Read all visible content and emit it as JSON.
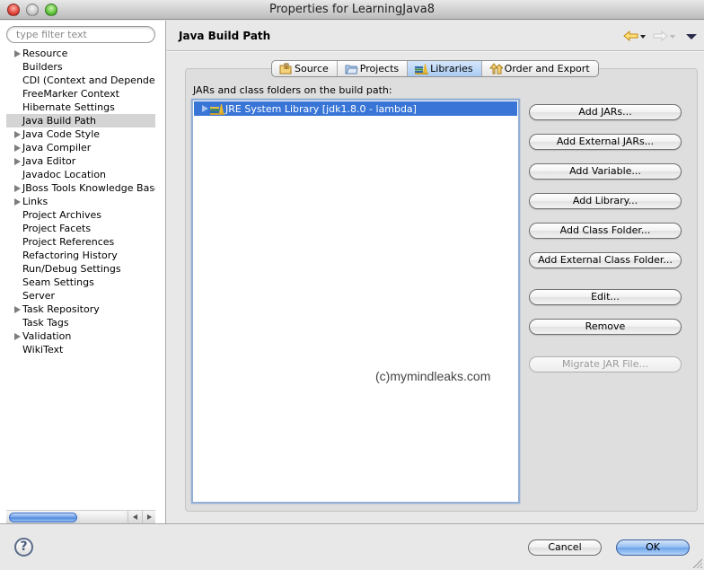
{
  "window": {
    "title": "Properties for LearningJava8"
  },
  "sidebar": {
    "filter_placeholder": "type filter text",
    "filter_value": "",
    "items": [
      {
        "label": "Resource",
        "expandable": true,
        "selected": false
      },
      {
        "label": "Builders",
        "expandable": false,
        "selected": false
      },
      {
        "label": "CDI (Context and Dependen",
        "expandable": false,
        "selected": false
      },
      {
        "label": "FreeMarker Context",
        "expandable": false,
        "selected": false
      },
      {
        "label": "Hibernate Settings",
        "expandable": false,
        "selected": false
      },
      {
        "label": "Java Build Path",
        "expandable": false,
        "selected": true
      },
      {
        "label": "Java Code Style",
        "expandable": true,
        "selected": false
      },
      {
        "label": "Java Compiler",
        "expandable": true,
        "selected": false
      },
      {
        "label": "Java Editor",
        "expandable": true,
        "selected": false
      },
      {
        "label": "Javadoc Location",
        "expandable": false,
        "selected": false
      },
      {
        "label": "JBoss Tools Knowledge Base",
        "expandable": true,
        "selected": false
      },
      {
        "label": "Links",
        "expandable": true,
        "selected": false
      },
      {
        "label": "Project Archives",
        "expandable": false,
        "selected": false
      },
      {
        "label": "Project Facets",
        "expandable": false,
        "selected": false
      },
      {
        "label": "Project References",
        "expandable": false,
        "selected": false
      },
      {
        "label": "Refactoring History",
        "expandable": false,
        "selected": false
      },
      {
        "label": "Run/Debug Settings",
        "expandable": false,
        "selected": false
      },
      {
        "label": "Seam Settings",
        "expandable": false,
        "selected": false
      },
      {
        "label": "Server",
        "expandable": false,
        "selected": false
      },
      {
        "label": "Task Repository",
        "expandable": true,
        "selected": false
      },
      {
        "label": "Task Tags",
        "expandable": false,
        "selected": false
      },
      {
        "label": "Validation",
        "expandable": true,
        "selected": false
      },
      {
        "label": "WikiText",
        "expandable": false,
        "selected": false
      }
    ]
  },
  "main": {
    "title": "Java Build Path",
    "nav": {
      "back_icon": "back-arrow-icon",
      "forward_icon": "forward-arrow-icon",
      "menu_icon": "view-menu-icon"
    },
    "tabs": [
      {
        "label": "Source",
        "icon": "source-folder-icon",
        "active": false
      },
      {
        "label": "Projects",
        "icon": "project-folder-icon",
        "active": false
      },
      {
        "label": "Libraries",
        "icon": "libraries-icon",
        "active": true
      },
      {
        "label": "Order and Export",
        "icon": "order-export-icon",
        "active": false
      }
    ],
    "list_label": "JARs and class folders on the build path:",
    "list_items": [
      {
        "label": "JRE System Library [jdk1.8.0 - lambda]",
        "selected": true,
        "expandable": true
      }
    ],
    "buttons": [
      {
        "label": "Add JARs...",
        "enabled": true
      },
      {
        "label": "Add External JARs...",
        "enabled": true
      },
      {
        "label": "Add Variable...",
        "enabled": true
      },
      {
        "label": "Add Library...",
        "enabled": true
      },
      {
        "label": "Add Class Folder...",
        "enabled": true
      },
      {
        "label": "Add External Class Folder...",
        "enabled": true
      },
      {
        "label": "Edit...",
        "enabled": true
      },
      {
        "label": "Remove",
        "enabled": true
      },
      {
        "label": "Migrate JAR File...",
        "enabled": false
      }
    ],
    "watermark": "(c)mymindleaks.com"
  },
  "footer": {
    "help_label": "?",
    "cancel_label": "Cancel",
    "ok_label": "OK"
  },
  "colors": {
    "selection_blue": "#3875d7",
    "sidebar_selection": "#d4d4d4",
    "default_button_blue": "#6aa2ea"
  }
}
